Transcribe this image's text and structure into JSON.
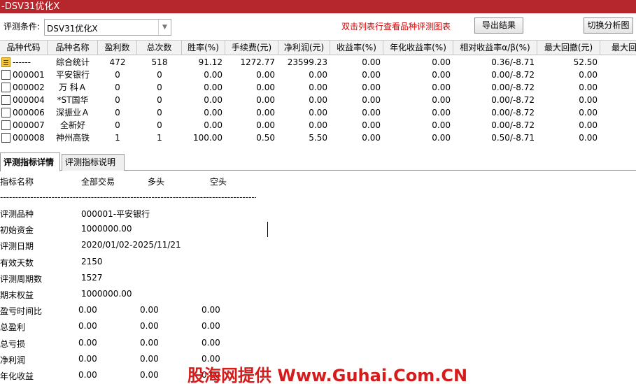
{
  "window": {
    "title": "-DSV31优化X"
  },
  "toolbar": {
    "condition_label": "评测条件:",
    "condition_value": "DSV31优化X",
    "hint": "双击列表行查看品种评测图表",
    "export_label": "导出结果",
    "switch_label": "切换分析图"
  },
  "grid": {
    "columns": [
      "品种代码",
      "品种名称",
      "盈利数",
      "总次数",
      "胜率(%)",
      "手续费(元)",
      "净利润(元)",
      "收益率(%)",
      "年化收益率(%)",
      "相对收益率α/β(%)",
      "最大回撤(元)",
      "最大回"
    ],
    "rows": [
      {
        "icon": "summary",
        "code": "------",
        "name": "综合统计",
        "wins": "472",
        "total": "518",
        "winrate": "91.12",
        "fee": "1272.77",
        "profit": "23599.23",
        "ret": "0.00",
        "annual": "0.00",
        "relative": "0.36/-8.71",
        "drawdown": "52.50"
      },
      {
        "icon": "doc",
        "code": "000001",
        "name": "平安银行",
        "wins": "0",
        "total": "0",
        "winrate": "0.00",
        "fee": "0.00",
        "profit": "0.00",
        "ret": "0.00",
        "annual": "0.00",
        "relative": "0.00/-8.72",
        "drawdown": "0.00"
      },
      {
        "icon": "doc",
        "code": "000002",
        "name": "万 科Ａ",
        "wins": "0",
        "total": "0",
        "winrate": "0.00",
        "fee": "0.00",
        "profit": "0.00",
        "ret": "0.00",
        "annual": "0.00",
        "relative": "0.00/-8.72",
        "drawdown": "0.00"
      },
      {
        "icon": "doc",
        "code": "000004",
        "name": "*ST国华",
        "wins": "0",
        "total": "0",
        "winrate": "0.00",
        "fee": "0.00",
        "profit": "0.00",
        "ret": "0.00",
        "annual": "0.00",
        "relative": "0.00/-8.72",
        "drawdown": "0.00"
      },
      {
        "icon": "doc",
        "code": "000006",
        "name": "深振业Ａ",
        "wins": "0",
        "total": "0",
        "winrate": "0.00",
        "fee": "0.00",
        "profit": "0.00",
        "ret": "0.00",
        "annual": "0.00",
        "relative": "0.00/-8.72",
        "drawdown": "0.00"
      },
      {
        "icon": "doc",
        "code": "000007",
        "name": "全新好",
        "wins": "0",
        "total": "0",
        "winrate": "0.00",
        "fee": "0.00",
        "profit": "0.00",
        "ret": "0.00",
        "annual": "0.00",
        "relative": "0.00/-8.72",
        "drawdown": "0.00"
      },
      {
        "icon": "doc",
        "code": "000008",
        "name": "神州高铁",
        "wins": "1",
        "total": "1",
        "winrate": "100.00",
        "fee": "0.50",
        "profit": "5.50",
        "ret": "0.00",
        "annual": "0.00",
        "relative": "0.50/-8.71",
        "drawdown": "0.00"
      }
    ]
  },
  "tabs": [
    {
      "label": "评测指标详情",
      "active": true
    },
    {
      "label": "评测指标说明",
      "active": false
    }
  ],
  "detail": {
    "header": {
      "name": "指标名称",
      "all": "全部交易",
      "long": "多头",
      "short": "空头"
    },
    "separator": "-------------------------------------------------------------------------------------------",
    "items": [
      {
        "label": "评测品种",
        "v1": "000001-平安银行"
      },
      {
        "label": "初始资金",
        "v1": "1000000.00"
      },
      {
        "label": "评测日期",
        "v1": "2020/01/02-2025/11/21"
      },
      {
        "label": "有效天数",
        "v1": "2150"
      },
      {
        "label": "评测周期数",
        "v1": "1527"
      },
      {
        "label": "期末权益",
        "v1": "1000000.00"
      },
      {
        "label": "盈亏时间比",
        "v1": "0.00",
        "v2": "0.00",
        "v3": "0.00"
      },
      {
        "label": "总盈利",
        "v1": "0.00",
        "v2": "0.00",
        "v3": "0.00"
      },
      {
        "label": "总亏损",
        "v1": "0.00",
        "v2": "0.00",
        "v3": "0.00"
      },
      {
        "label": "净利润",
        "v1": "0.00",
        "v2": "0.00",
        "v3": "0.00"
      },
      {
        "label": "年化收益",
        "v1": "0.00",
        "v2": "0.00",
        "v3": "0.00"
      }
    ]
  },
  "watermark": "股海网提供 Www.Guhai.Com.CN"
}
